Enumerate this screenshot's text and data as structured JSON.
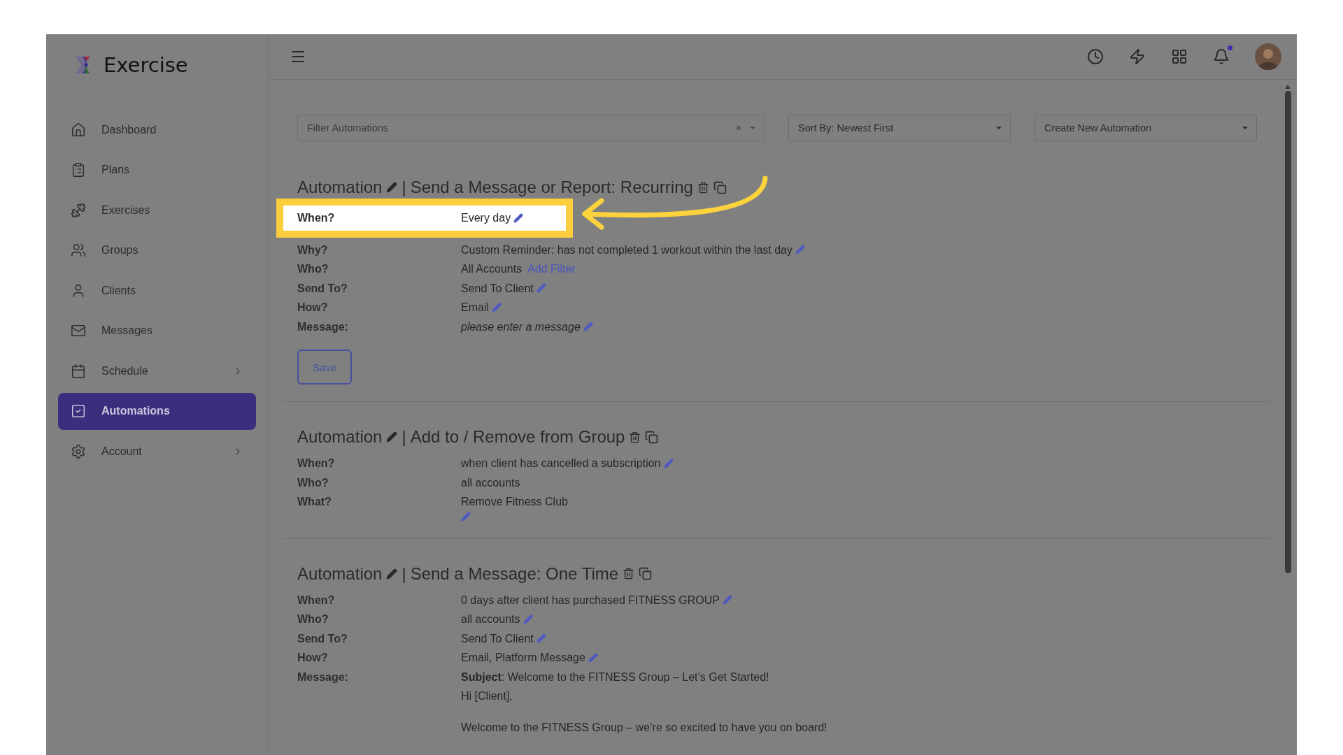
{
  "brand": {
    "name": "Exercise"
  },
  "sidebar": {
    "items": [
      {
        "label": "Dashboard",
        "selected": false,
        "has_submenu": false
      },
      {
        "label": "Plans",
        "selected": false,
        "has_submenu": false
      },
      {
        "label": "Exercises",
        "selected": false,
        "has_submenu": false
      },
      {
        "label": "Groups",
        "selected": false,
        "has_submenu": false
      },
      {
        "label": "Clients",
        "selected": false,
        "has_submenu": false
      },
      {
        "label": "Messages",
        "selected": false,
        "has_submenu": false
      },
      {
        "label": "Schedule",
        "selected": false,
        "has_submenu": true
      },
      {
        "label": "Automations",
        "selected": true,
        "has_submenu": false
      },
      {
        "label": "Account",
        "selected": false,
        "has_submenu": true
      }
    ]
  },
  "topbar": {
    "notifications_unread": true
  },
  "toolbar": {
    "filter": {
      "placeholder": "Filter Automations",
      "clear": "×"
    },
    "sort": {
      "value": "Sort By: Newest First"
    },
    "create": {
      "value": "Create New Automation"
    }
  },
  "automations": [
    {
      "prefix": "Automation",
      "separator": "|",
      "type": "Send a Message or Report: Recurring",
      "rows": [
        {
          "label": "When?",
          "value": "Every day",
          "editable": true,
          "highlighted": true
        },
        {
          "label": "Why?",
          "value": "Custom Reminder: has not completed 1 workout within the last day",
          "editable": true,
          "highlighted": false
        },
        {
          "label": "Who?",
          "value": "All Accounts",
          "link": "Add Filter",
          "editable": false,
          "highlighted": false
        },
        {
          "label": "Send To?",
          "value": "Send To Client",
          "editable": true,
          "highlighted": false
        },
        {
          "label": "How?",
          "value": "Email",
          "editable": true,
          "highlighted": false
        },
        {
          "label": "Message:",
          "value": "please enter a message",
          "placeholder": true,
          "editable": true,
          "highlighted": false
        }
      ],
      "save_button": "Save"
    },
    {
      "prefix": "Automation",
      "separator": "|",
      "type": "Add to / Remove from Group",
      "rows": [
        {
          "label": "When?",
          "value": "when client has cancelled a subscription",
          "editable": true,
          "highlighted": false
        },
        {
          "label": "Who?",
          "value": "all accounts",
          "editable": false,
          "highlighted": false
        },
        {
          "label": "What?",
          "value": "Remove Fitness Club",
          "editable": true,
          "pencil_below": true,
          "highlighted": false
        }
      ]
    },
    {
      "prefix": "Automation",
      "separator": "|",
      "type": "Send a Message: One Time",
      "rows": [
        {
          "label": "When?",
          "value": "0 days after client has purchased FITNESS GROUP",
          "editable": true,
          "highlighted": false
        },
        {
          "label": "Who?",
          "value": "all accounts",
          "editable": true,
          "highlighted": false
        },
        {
          "label": "Send To?",
          "value": "Send To Client",
          "editable": true,
          "highlighted": false
        },
        {
          "label": "How?",
          "value": "Email, Platform Message",
          "editable": true,
          "highlighted": false
        },
        {
          "label": "Message:",
          "paragraphs": [
            [
              "**Subject**: Welcome to the FITNESS Group – Let’s Get Started!",
              "Hi [Client],"
            ],
            [
              "Welcome to the FITNESS Group – we’re so excited to have you on board!"
            ]
          ],
          "editable": false,
          "highlighted": false
        }
      ]
    }
  ]
}
